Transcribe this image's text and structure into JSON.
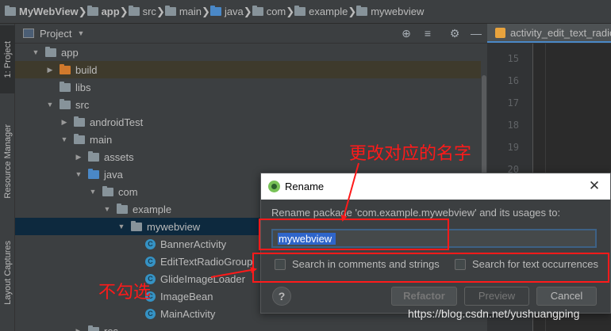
{
  "breadcrumb": [
    {
      "label": "MyWebView",
      "bold": true,
      "icon": "folder-icon",
      "color": "#87939a"
    },
    {
      "label": "app",
      "bold": true,
      "icon": "module-folder-icon",
      "color": "#87939a"
    },
    {
      "label": "src",
      "bold": false,
      "icon": "folder-icon",
      "color": "#87939a"
    },
    {
      "label": "main",
      "bold": false,
      "icon": "folder-icon",
      "color": "#87939a"
    },
    {
      "label": "java",
      "bold": false,
      "icon": "source-folder-icon",
      "color": "#4a88c7"
    },
    {
      "label": "com",
      "bold": false,
      "icon": "package-icon",
      "color": "#87939a"
    },
    {
      "label": "example",
      "bold": false,
      "icon": "package-icon",
      "color": "#87939a"
    },
    {
      "label": "mywebview",
      "bold": false,
      "icon": "package-icon",
      "color": "#87939a"
    }
  ],
  "toolstrip": {
    "project": "1: Project",
    "resource_manager": "Resource Manager",
    "layout_captures": "Layout Captures"
  },
  "project_panel": {
    "title": "Project",
    "icons": [
      "locate-icon",
      "collapse-all-icon",
      "gear-icon",
      "hide-icon"
    ]
  },
  "tree": [
    {
      "label": "app",
      "level": 1,
      "arrow": "down",
      "icon": "module-folder-icon",
      "color": "#87939a"
    },
    {
      "label": "build",
      "level": 2,
      "arrow": "right",
      "icon": "folder-icon",
      "color": "#d0792c",
      "state": "build"
    },
    {
      "label": "libs",
      "level": 2,
      "arrow": "none",
      "icon": "folder-icon",
      "color": "#87939a"
    },
    {
      "label": "src",
      "level": 2,
      "arrow": "down",
      "icon": "folder-icon",
      "color": "#87939a"
    },
    {
      "label": "androidTest",
      "level": 3,
      "arrow": "right",
      "icon": "folder-icon",
      "color": "#87939a"
    },
    {
      "label": "main",
      "level": 3,
      "arrow": "down",
      "icon": "folder-icon",
      "color": "#87939a"
    },
    {
      "label": "assets",
      "level": 4,
      "arrow": "right",
      "icon": "assets-folder-icon",
      "color": "#87939a"
    },
    {
      "label": "java",
      "level": 4,
      "arrow": "down",
      "icon": "source-folder-icon",
      "color": "#4a88c7"
    },
    {
      "label": "com",
      "level": 5,
      "arrow": "down",
      "icon": "package-icon",
      "color": "#87939a"
    },
    {
      "label": "example",
      "level": 6,
      "arrow": "down",
      "icon": "package-icon",
      "color": "#87939a"
    },
    {
      "label": "mywebview",
      "level": 7,
      "arrow": "down",
      "icon": "package-icon",
      "color": "#87939a",
      "state": "selected"
    },
    {
      "label": "BannerActivity",
      "level": 8,
      "arrow": "none",
      "icon": "class-icon",
      "color": "#3592c4"
    },
    {
      "label": "EditTextRadioGroup",
      "level": 8,
      "arrow": "none",
      "icon": "class-icon",
      "color": "#3592c4"
    },
    {
      "label": "GlideImageLoader",
      "level": 8,
      "arrow": "none",
      "icon": "class-icon",
      "color": "#3592c4"
    },
    {
      "label": "ImageBean",
      "level": 8,
      "arrow": "none",
      "icon": "class-icon",
      "color": "#3592c4"
    },
    {
      "label": "MainActivity",
      "level": 8,
      "arrow": "none",
      "icon": "class-icon",
      "color": "#3592c4"
    },
    {
      "label": "res",
      "level": 4,
      "arrow": "right",
      "icon": "folder-icon",
      "color": "#87939a"
    }
  ],
  "editor": {
    "tab": "activity_edit_text_radio",
    "line_numbers": [
      "15",
      "16",
      "17",
      "18",
      "19",
      "20"
    ]
  },
  "dialog": {
    "title": "Rename",
    "prompt": "Rename package 'com.example.mywebview' and its usages to:",
    "input_value": "mywebview",
    "option_comments": "Search in comments and strings",
    "option_text": "Search for text occurrences",
    "comments_checked": false,
    "text_checked": false,
    "help": "?",
    "refactor": "Refactor",
    "preview": "Preview",
    "cancel": "Cancel"
  },
  "annotations": {
    "rename_hint": "更改对应的名字",
    "no_check_hint": "不勾选",
    "color": "#ff1a1a"
  },
  "watermark": "https://blog.csdn.net/yushuangping"
}
